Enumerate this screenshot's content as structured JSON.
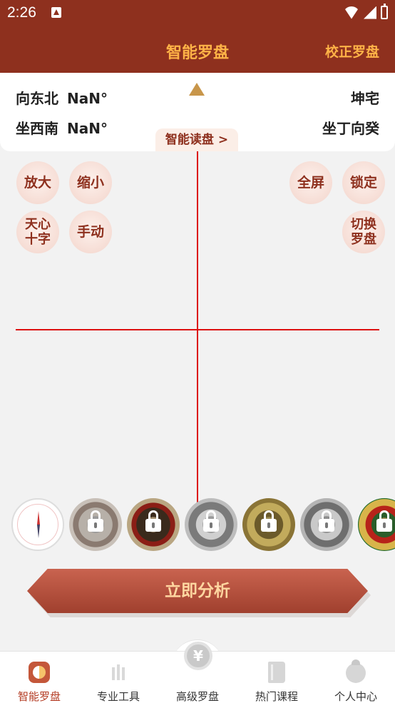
{
  "status_bar": {
    "time": "2:26"
  },
  "header": {
    "title": "智能罗盘",
    "calibrate": "校正罗盘"
  },
  "readout": {
    "facing_label": "向东北",
    "facing_degree": "NaN°",
    "sitting_label": "坐西南",
    "sitting_degree": "NaN°",
    "house_type": "坤宅",
    "mountain": "坐丁向癸",
    "smart_read": "智能读盘 >"
  },
  "controls": {
    "zoom_in": "放大",
    "zoom_out": "缩小",
    "fullscreen": "全屏",
    "lock": "锁定",
    "crosshair_line1": "天心",
    "crosshair_line2": "十字",
    "manual": "手动",
    "switch_line1": "切换",
    "switch_line2": "罗盘"
  },
  "compass_options": [
    {
      "name": "basic-compass",
      "locked": false
    },
    {
      "name": "compass-2",
      "locked": true
    },
    {
      "name": "compass-3",
      "locked": true
    },
    {
      "name": "compass-4",
      "locked": true
    },
    {
      "name": "compass-5",
      "locked": true
    },
    {
      "name": "compass-6",
      "locked": true
    },
    {
      "name": "compass-7",
      "locked": true
    }
  ],
  "analyze_button": "立即分析",
  "bottom_nav": [
    {
      "label": "智能罗盘",
      "icon": "taiji-icon",
      "active": true
    },
    {
      "label": "专业工具",
      "icon": "tools-icon",
      "active": false
    },
    {
      "label": "高级罗盘",
      "icon": "yuan-coin-icon",
      "active": false
    },
    {
      "label": "热门课程",
      "icon": "book-icon",
      "active": false
    },
    {
      "label": "个人中心",
      "icon": "person-icon",
      "active": false
    }
  ],
  "colors": {
    "header_bg": "#8e301e",
    "accent": "#ffb347",
    "crosshair": "#dd1111",
    "active_nav": "#b33a22"
  }
}
